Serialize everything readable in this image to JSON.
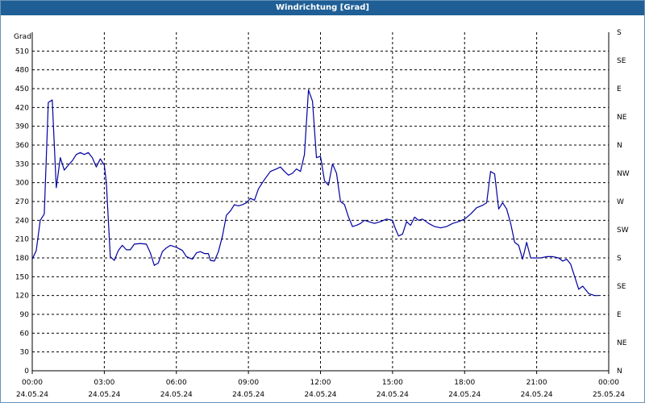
{
  "window": {
    "title": "Windrichtung [Grad]"
  },
  "colors": {
    "titlebar": "#1f5f96",
    "line": "#0000a0",
    "grid": "#000000"
  },
  "chart_data": {
    "type": "line",
    "title": "Windrichtung [Grad]",
    "ylabel": "Grad",
    "ylim": [
      0,
      540
    ],
    "xlim": [
      "24.05.24 00:00",
      "25.05.24 00:00"
    ],
    "grid": true,
    "y_ticks": [
      0,
      30,
      60,
      90,
      120,
      150,
      180,
      210,
      240,
      270,
      300,
      330,
      360,
      390,
      420,
      450,
      480,
      510
    ],
    "x_ticks": [
      {
        "time": "00:00",
        "date": "24.05.24"
      },
      {
        "time": "03:00",
        "date": "24.05.24"
      },
      {
        "time": "06:00",
        "date": "24.05.24"
      },
      {
        "time": "09:00",
        "date": "24.05.24"
      },
      {
        "time": "12:00",
        "date": "24.05.24"
      },
      {
        "time": "15:00",
        "date": "24.05.24"
      },
      {
        "time": "18:00",
        "date": "24.05.24"
      },
      {
        "time": "21:00",
        "date": "24.05.24"
      },
      {
        "time": "00:00",
        "date": "25.05.24"
      }
    ],
    "secondary_axis": {
      "values": [
        0,
        45,
        90,
        135,
        180,
        225,
        270,
        315,
        360,
        405,
        450,
        495,
        540
      ],
      "labels": [
        "N",
        "NE",
        "E",
        "SE",
        "S",
        "SW",
        "W",
        "NW",
        "N",
        "NE",
        "E",
        "SE",
        "S"
      ]
    },
    "series": [
      {
        "points": [
          [
            "24.05.24 00:00",
            178
          ],
          [
            "24.05.24 00:10",
            192
          ],
          [
            "24.05.24 00:20",
            240
          ],
          [
            "24.05.24 00:30",
            250
          ],
          [
            "24.05.24 00:40",
            428
          ],
          [
            "24.05.24 00:50",
            432
          ],
          [
            "24.05.24 01:00",
            292
          ],
          [
            "24.05.24 01:10",
            340
          ],
          [
            "24.05.24 01:20",
            320
          ],
          [
            "24.05.24 01:30",
            328
          ],
          [
            "24.05.24 01:40",
            335
          ],
          [
            "24.05.24 01:50",
            345
          ],
          [
            "24.05.24 02:00",
            348
          ],
          [
            "24.05.24 02:10",
            345
          ],
          [
            "24.05.24 02:20",
            348
          ],
          [
            "24.05.24 02:30",
            340
          ],
          [
            "24.05.24 02:40",
            325
          ],
          [
            "24.05.24 02:50",
            338
          ],
          [
            "24.05.24 03:00",
            328
          ],
          [
            "24.05.24 03:05",
            300
          ],
          [
            "24.05.24 03:15",
            182
          ],
          [
            "24.05.24 03:25",
            176
          ],
          [
            "24.05.24 03:35",
            192
          ],
          [
            "24.05.24 03:45",
            200
          ],
          [
            "24.05.24 03:55",
            193
          ],
          [
            "24.05.24 04:05",
            193
          ],
          [
            "24.05.24 04:15",
            202
          ],
          [
            "24.05.24 04:30",
            203
          ],
          [
            "24.05.24 04:45",
            202
          ],
          [
            "24.05.24 04:55",
            188
          ],
          [
            "24.05.24 05:05",
            168
          ],
          [
            "24.05.24 05:15",
            172
          ],
          [
            "24.05.24 05:25",
            190
          ],
          [
            "24.05.24 05:35",
            196
          ],
          [
            "24.05.24 05:45",
            200
          ],
          [
            "24.05.24 06:00",
            197
          ],
          [
            "24.05.24 06:15",
            192
          ],
          [
            "24.05.24 06:25",
            182
          ],
          [
            "24.05.24 06:40",
            178
          ],
          [
            "24.05.24 06:50",
            188
          ],
          [
            "24.05.24 07:00",
            190
          ],
          [
            "24.05.24 07:10",
            187
          ],
          [
            "24.05.24 07:20",
            187
          ],
          [
            "24.05.24 07:25",
            176
          ],
          [
            "24.05.24 07:35",
            175
          ],
          [
            "24.05.24 07:45",
            190
          ],
          [
            "24.05.24 07:55",
            215
          ],
          [
            "24.05.24 08:05",
            248
          ],
          [
            "24.05.24 08:15",
            255
          ],
          [
            "24.05.24 08:25",
            265
          ],
          [
            "24.05.24 08:35",
            263
          ],
          [
            "24.05.24 08:45",
            265
          ],
          [
            "24.05.24 08:55",
            268
          ],
          [
            "24.05.24 09:05",
            275
          ],
          [
            "24.05.24 09:15",
            272
          ],
          [
            "24.05.24 09:25",
            290
          ],
          [
            "24.05.24 09:40",
            305
          ],
          [
            "24.05.24 09:55",
            318
          ],
          [
            "24.05.24 10:10",
            322
          ],
          [
            "24.05.24 10:20",
            325
          ],
          [
            "24.05.24 10:30",
            318
          ],
          [
            "24.05.24 10:40",
            312
          ],
          [
            "24.05.24 10:50",
            315
          ],
          [
            "24.05.24 11:00",
            322
          ],
          [
            "24.05.24 11:10",
            318
          ],
          [
            "24.05.24 11:20",
            345
          ],
          [
            "24.05.24 11:30",
            448
          ],
          [
            "24.05.24 11:40",
            430
          ],
          [
            "24.05.24 11:50",
            340
          ],
          [
            "24.05.24 12:00",
            342
          ],
          [
            "24.05.24 12:10",
            303
          ],
          [
            "24.05.24 12:20",
            296
          ],
          [
            "24.05.24 12:30",
            330
          ],
          [
            "24.05.24 12:40",
            315
          ],
          [
            "24.05.24 12:50",
            270
          ],
          [
            "24.05.24 13:00",
            265
          ],
          [
            "24.05.24 13:10",
            245
          ],
          [
            "24.05.24 13:20",
            230
          ],
          [
            "24.05.24 13:30",
            232
          ],
          [
            "24.05.24 13:40",
            235
          ],
          [
            "24.05.24 13:50",
            240
          ],
          [
            "24.05.24 14:00",
            238
          ],
          [
            "24.05.24 14:15",
            235
          ],
          [
            "24.05.24 14:30",
            238
          ],
          [
            "24.05.24 14:45",
            242
          ],
          [
            "24.05.24 15:00",
            240
          ],
          [
            "24.05.24 15:05",
            230
          ],
          [
            "24.05.24 15:15",
            215
          ],
          [
            "24.05.24 15:25",
            218
          ],
          [
            "24.05.24 15:35",
            238
          ],
          [
            "24.05.24 15:45",
            232
          ],
          [
            "24.05.24 15:55",
            245
          ],
          [
            "24.05.24 16:05",
            240
          ],
          [
            "24.05.24 16:15",
            242
          ],
          [
            "24.05.24 16:30",
            235
          ],
          [
            "24.05.24 16:45",
            230
          ],
          [
            "24.05.24 17:00",
            228
          ],
          [
            "24.05.24 17:15",
            230
          ],
          [
            "24.05.24 17:30",
            235
          ],
          [
            "24.05.24 17:45",
            238
          ],
          [
            "24.05.24 18:00",
            242
          ],
          [
            "24.05.24 18:15",
            250
          ],
          [
            "24.05.24 18:30",
            260
          ],
          [
            "24.05.24 18:45",
            264
          ],
          [
            "24.05.24 18:55",
            268
          ],
          [
            "24.05.24 19:05",
            318
          ],
          [
            "24.05.24 19:15",
            314
          ],
          [
            "24.05.24 19:25",
            258
          ],
          [
            "24.05.24 19:35",
            268
          ],
          [
            "24.05.24 19:45",
            258
          ],
          [
            "24.05.24 19:55",
            235
          ],
          [
            "24.05.24 20:05",
            205
          ],
          [
            "24.05.24 20:15",
            200
          ],
          [
            "24.05.24 20:25",
            178
          ],
          [
            "24.05.24 20:35",
            205
          ],
          [
            "24.05.24 20:45",
            180
          ],
          [
            "24.05.24 20:55",
            180
          ],
          [
            "24.05.24 21:10",
            180
          ],
          [
            "24.05.24 21:25",
            182
          ],
          [
            "24.05.24 21:40",
            182
          ],
          [
            "24.05.24 21:55",
            180
          ],
          [
            "24.05.24 22:05",
            175
          ],
          [
            "24.05.24 22:15",
            178
          ],
          [
            "24.05.24 22:25",
            170
          ],
          [
            "24.05.24 22:35",
            150
          ],
          [
            "24.05.24 22:45",
            130
          ],
          [
            "24.05.24 22:55",
            135
          ],
          [
            "24.05.24 23:10",
            123
          ],
          [
            "24.05.24 23:25",
            120
          ],
          [
            "24.05.24 23:35",
            120
          ]
        ]
      }
    ]
  }
}
